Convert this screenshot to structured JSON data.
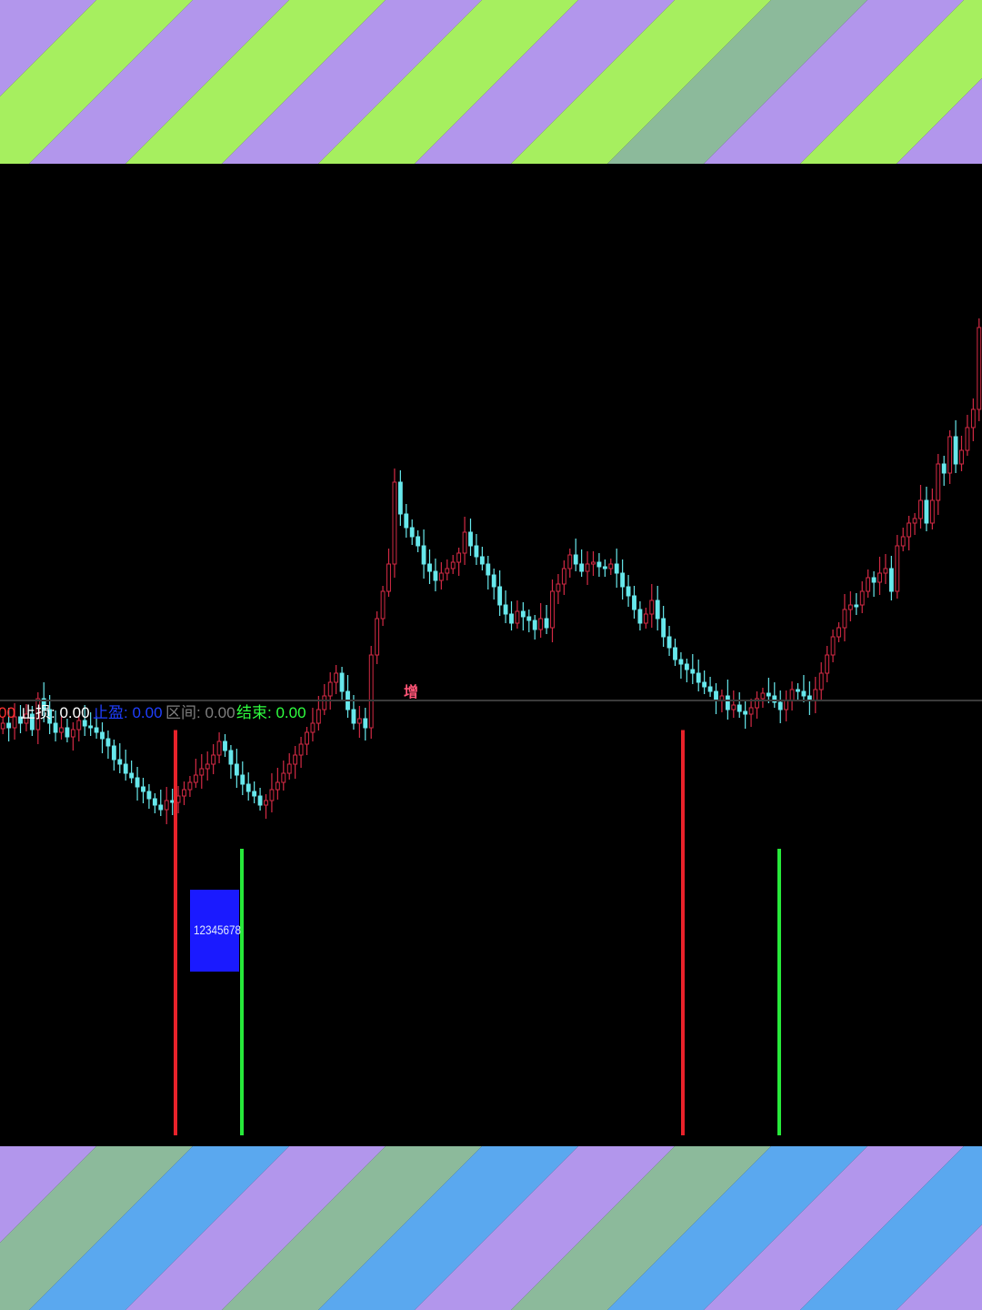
{
  "colors": {
    "purple": "#b296ec",
    "green": "#a6ef5f",
    "sage": "#8cba9b",
    "blue": "#5aa8ef",
    "background": "#000000",
    "up": "#d42a45",
    "down": "#67e8ec",
    "divider": "#3a3a3a"
  },
  "top_band": {
    "pattern": [
      "purple",
      "green",
      "purple",
      "green",
      "purple",
      "green",
      "purple",
      "green",
      "sage",
      "purple",
      "green",
      "purple",
      "sage",
      "purple"
    ]
  },
  "bottom_band": {
    "pattern": [
      "purple",
      "sage",
      "blue",
      "purple",
      "sage",
      "blue",
      "purple",
      "sage",
      "blue",
      "purple",
      "blue",
      "purple",
      "green"
    ]
  },
  "main_chart": {
    "marker_label": "增",
    "closes": [
      615,
      620,
      608,
      615,
      605,
      622,
      588,
      600,
      615,
      625,
      620,
      630,
      622,
      612,
      618,
      620,
      625,
      632,
      640,
      655,
      660,
      670,
      675,
      685,
      690,
      698,
      705,
      710,
      700,
      702,
      695,
      688,
      680,
      672,
      665,
      660,
      650,
      635,
      645,
      660,
      672,
      682,
      690,
      695,
      705,
      700,
      688,
      680,
      670,
      660,
      650,
      638,
      625,
      615,
      600,
      585,
      570,
      560,
      580,
      600,
      615,
      610,
      620,
      540,
      500,
      470,
      440,
      350,
      385,
      400,
      410,
      420,
      440,
      448,
      458,
      450,
      445,
      438,
      428,
      405,
      420,
      432,
      440,
      452,
      465,
      485,
      495,
      505,
      492,
      498,
      502,
      512,
      500,
      510,
      470,
      462,
      445,
      430,
      440,
      448,
      440,
      438,
      443,
      445,
      440,
      450,
      465,
      475,
      490,
      505,
      495,
      480,
      500,
      520,
      532,
      545,
      550,
      556,
      560,
      570,
      575,
      580,
      590,
      585,
      600,
      595,
      602,
      605,
      598,
      588,
      582,
      585,
      592,
      600,
      590,
      578,
      580,
      585,
      590,
      578,
      560,
      540,
      520,
      510,
      490,
      485,
      485,
      470,
      455,
      460,
      450,
      445,
      470,
      420,
      410,
      395,
      390,
      370,
      395,
      370,
      330,
      340,
      300,
      330,
      315,
      290,
      270,
      180
    ]
  },
  "indicator": {
    "labels": [
      {
        "text": "00",
        "color": "#ff3030"
      },
      {
        "text": "止损: 0.00",
        "color": "#ffffff"
      },
      {
        "text": "止盈: 0.00",
        "color": "#1f3fff"
      },
      {
        "text": "区间: 0.00",
        "color": "#7f7f7f"
      },
      {
        "text": "结束: 0.00",
        "color": "#2fff3f"
      }
    ],
    "box_label": "12345678",
    "signals": [
      {
        "color": "red",
        "level": 0.99
      },
      {
        "color": "green",
        "level": 0.7
      },
      {
        "color": "red",
        "level": 0.99
      },
      {
        "color": "green",
        "level": 0.7
      }
    ]
  }
}
